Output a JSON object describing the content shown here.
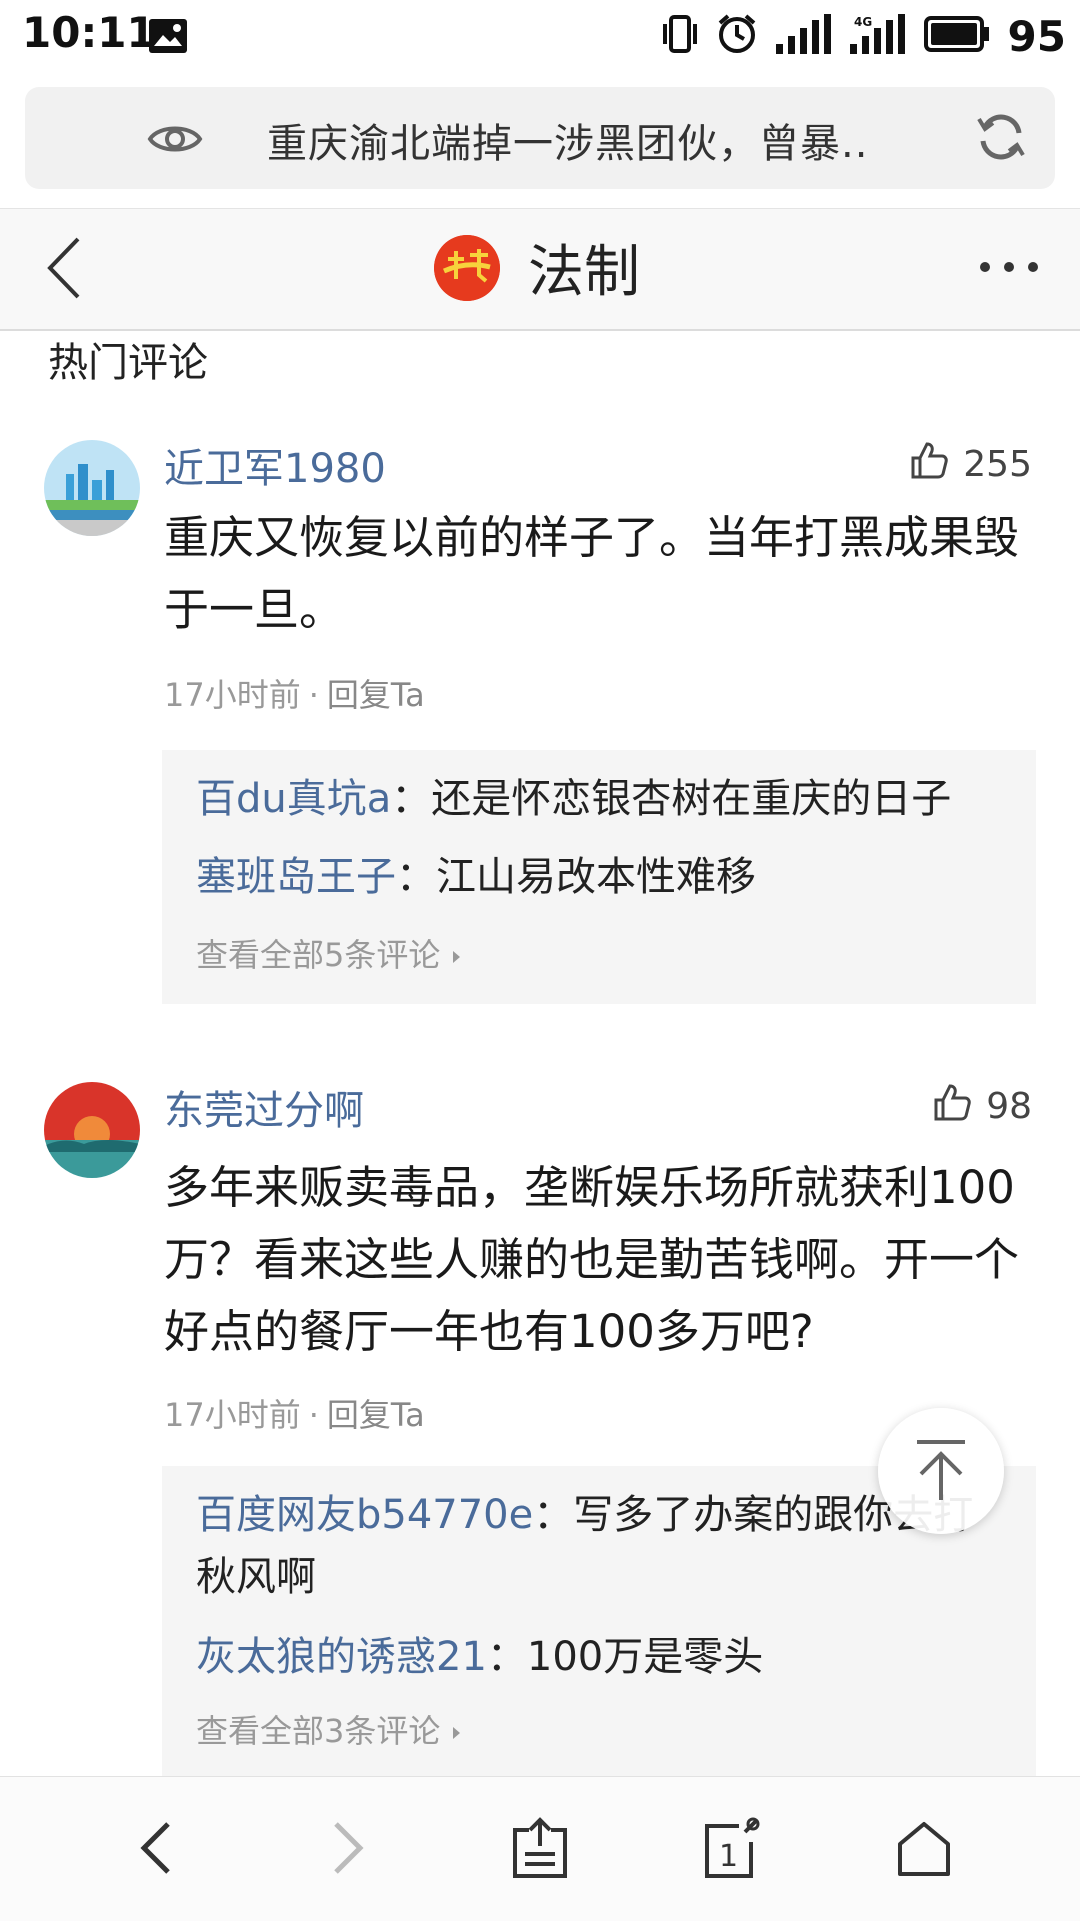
{
  "status_bar": {
    "time": "10:11",
    "battery": "95"
  },
  "url_bar": {
    "title": "重庆渝北端掉一涉黑团伙，曾暴.."
  },
  "nav": {
    "title": "法制"
  },
  "section": {
    "title": "热门评论"
  },
  "comments": [
    {
      "user": "近卫军1980",
      "likes": "255",
      "text": "重庆又恢复以前的样子了。当年打黑成果毁于一旦。",
      "time": "17小时前",
      "sep": "·",
      "reply_label": "回复Ta",
      "replies": [
        {
          "name": "百du真坑a",
          "colon": "：",
          "text": "还是怀恋银杏树在重庆的日子"
        },
        {
          "name": "塞班岛王子",
          "colon": "：",
          "text": "江山易改本性难移"
        }
      ],
      "view_all": "查看全部5条评论"
    },
    {
      "user": "东莞过分啊",
      "likes": "98",
      "text": "多年来贩卖毒品，垄断娱乐场所就获利100万？看来这些人赚的也是勤苦钱啊。开一个好点的餐厅一年也有100多万吧?",
      "time": "17小时前",
      "sep": "·",
      "reply_label": "回复Ta",
      "replies": [
        {
          "name": "百度网友b54770e",
          "colon": "：",
          "text": "写多了办案的跟你去打秋风啊"
        },
        {
          "name": "灰太狼的诱惑21",
          "colon": "：",
          "text": "100万是零头"
        }
      ],
      "view_all": "查看全部3条评论"
    }
  ]
}
